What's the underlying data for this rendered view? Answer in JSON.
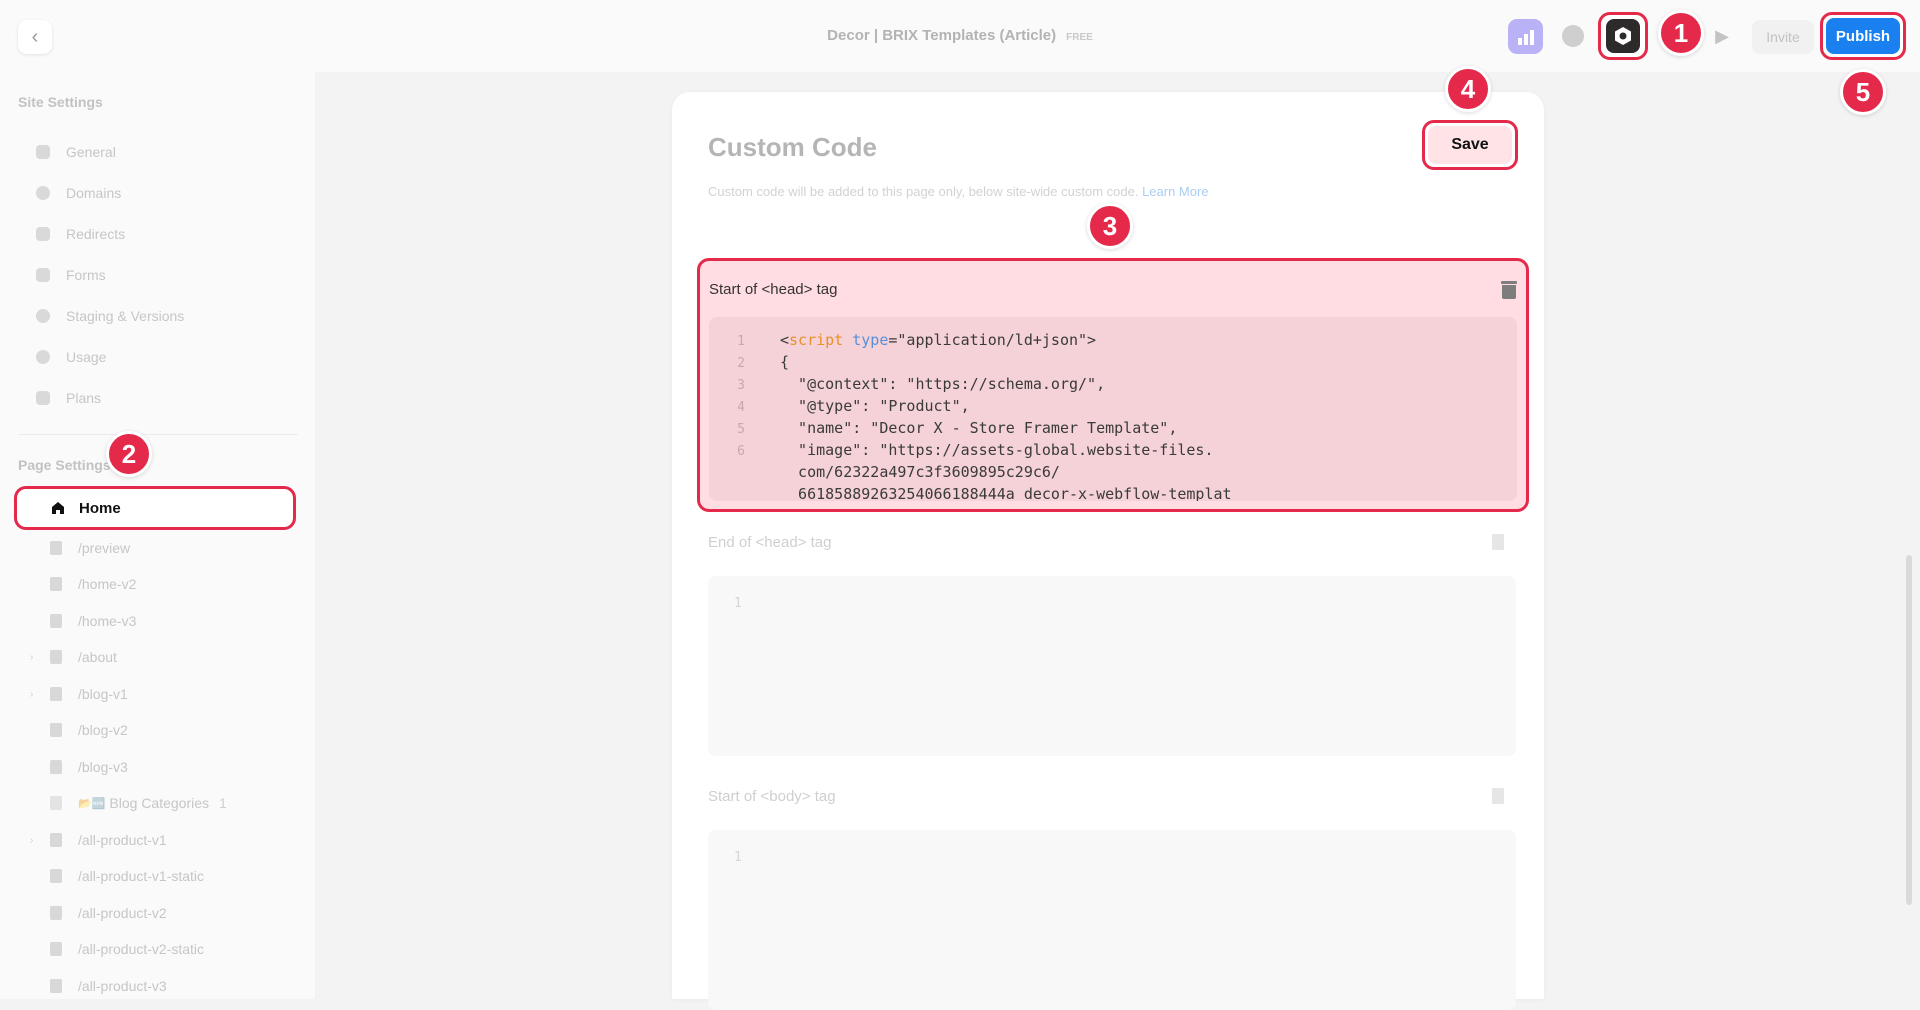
{
  "topbar": {
    "title": "Decor | BRIX Templates (Article)",
    "plan_badge": "FREE",
    "invite_label": "Invite",
    "publish_label": "Publish"
  },
  "sidebar": {
    "site_settings_heading": "Site Settings",
    "site_items": [
      {
        "label": "General"
      },
      {
        "label": "Domains"
      },
      {
        "label": "Redirects"
      },
      {
        "label": "Forms"
      },
      {
        "label": "Staging & Versions"
      },
      {
        "label": "Usage"
      },
      {
        "label": "Plans"
      }
    ],
    "page_settings_heading": "Page Settings",
    "home_label": "Home",
    "pages": [
      {
        "label": "/preview"
      },
      {
        "label": "/home-v2"
      },
      {
        "label": "/home-v3"
      },
      {
        "label": "/about"
      },
      {
        "label": "/blog-v1"
      },
      {
        "label": "/blog-v2"
      },
      {
        "label": "/blog-v3"
      },
      {
        "label": "Blog Categories",
        "emoji": "📂🆕",
        "count": "1"
      },
      {
        "label": "/all-product-v1"
      },
      {
        "label": "/all-product-v1-static"
      },
      {
        "label": "/all-product-v2"
      },
      {
        "label": "/all-product-v2-static"
      },
      {
        "label": "/all-product-v3"
      }
    ]
  },
  "panel": {
    "title": "Custom Code",
    "subtitle": "Custom code will be added to this page only, below site-wide custom code.",
    "learn_more": "Learn More",
    "save_label": "Save",
    "head_start": {
      "label": "Start of <head> tag",
      "lines": [
        {
          "n": "1",
          "pre": "<",
          "tag": "script",
          "sp": " ",
          "attr": "type",
          "post": "=\"application/ld+json\">"
        },
        {
          "n": "2",
          "text": "{"
        },
        {
          "n": "3",
          "text": "  \"@context\": \"https://schema.org/\","
        },
        {
          "n": "4",
          "text": "  \"@type\": \"Product\","
        },
        {
          "n": "5",
          "text": "  \"name\": \"Decor X - Store Framer Template\","
        },
        {
          "n": "6",
          "text": "  \"image\": \"https://assets-global.website-files."
        },
        {
          "n": "",
          "text": "  com/62322a497c3f3609895c29c6/"
        },
        {
          "n": "",
          "text": "  66185889263254066188444a_decor-x-webflow-templat"
        }
      ]
    },
    "head_end": {
      "label": "End of <head> tag",
      "line": "1"
    },
    "body_start": {
      "label": "Start of <body> tag",
      "line": "1"
    }
  },
  "markers": [
    "1",
    "2",
    "3",
    "4",
    "5"
  ],
  "colors": {
    "highlight": "#e5294b",
    "publish": "#1a80ef",
    "analytics": "#b9b2f7"
  },
  "icons": [
    "back-chevron-icon",
    "analytics-icon",
    "globe-icon",
    "settings-icon",
    "play-icon",
    "home-icon",
    "file-icon",
    "trash-icon"
  ]
}
